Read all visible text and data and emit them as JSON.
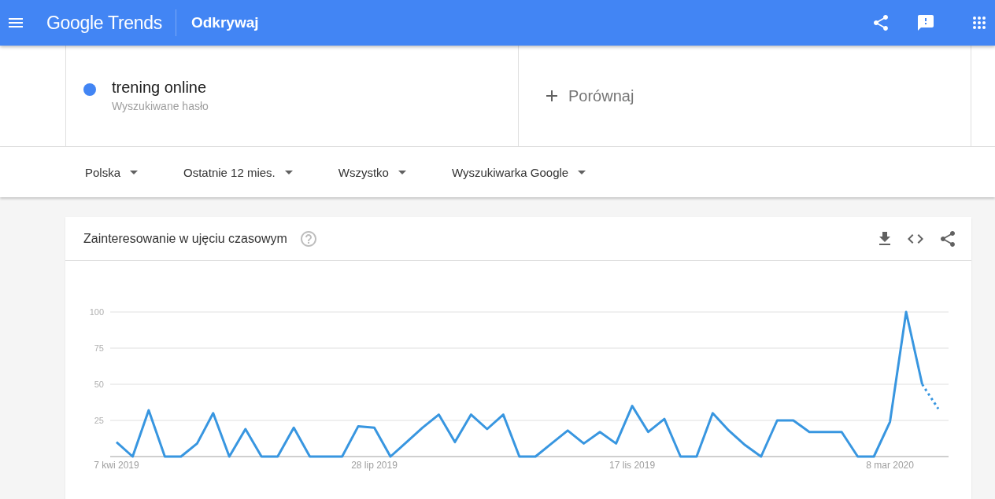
{
  "header": {
    "logo": "Google Trends",
    "section": "Odkrywaj"
  },
  "search": {
    "terms": [
      {
        "label": "trening online",
        "caption": "Wyszukiwane hasło",
        "color": "#4285f4"
      }
    ],
    "compare": {
      "label": "Porównaj"
    }
  },
  "filters": [
    {
      "label": "Polska"
    },
    {
      "label": "Ostatnie 12 mies."
    },
    {
      "label": "Wszystko"
    },
    {
      "label": "Wyszukiwarka Google"
    }
  ],
  "card": {
    "title": "Zainteresowanie w ujęciu czasowym",
    "last_point_partial": true,
    "chart_data": {
      "type": "line",
      "grid": true,
      "categories": [
        "7 kwi 2019",
        null,
        null,
        null,
        null,
        null,
        null,
        null,
        null,
        null,
        null,
        null,
        null,
        null,
        null,
        null,
        "28 lip 2019",
        null,
        null,
        null,
        null,
        null,
        null,
        null,
        null,
        null,
        null,
        null,
        null,
        null,
        null,
        null,
        "17 lis 2019",
        null,
        null,
        null,
        null,
        null,
        null,
        null,
        null,
        null,
        null,
        null,
        null,
        null,
        null,
        null,
        "8 mar 2020",
        null,
        null,
        null
      ],
      "ylim": [
        0,
        100
      ],
      "yticks": [
        25,
        50,
        75,
        100
      ],
      "series": [
        {
          "color": "#3896e0",
          "values": [
            10,
            0,
            32,
            0,
            0,
            9,
            30,
            0,
            19,
            0,
            0,
            20,
            0,
            0,
            0,
            21,
            20,
            0,
            10,
            20,
            29,
            10,
            29,
            19,
            29,
            0,
            0,
            9,
            18,
            9,
            17,
            9,
            35,
            17,
            26,
            0,
            0,
            30,
            18,
            8,
            0,
            25,
            25,
            17,
            17,
            17,
            0,
            0,
            24,
            100,
            50,
            33
          ]
        }
      ]
    }
  }
}
